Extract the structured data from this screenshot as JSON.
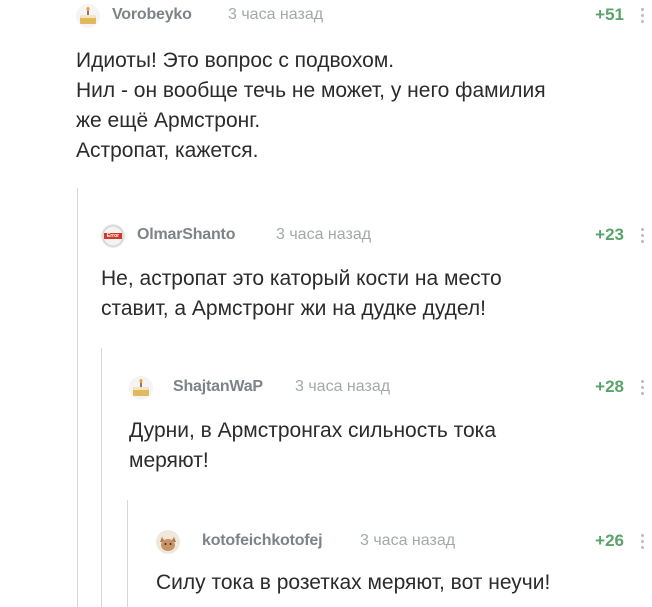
{
  "comments": [
    {
      "username": "Vorobeyko",
      "time": "3 часа назад",
      "rating": "+51",
      "avatar_icon": "cake-icon",
      "lines": [
        "Идиоты! Это вопрос с подвохом.",
        "Нил - он вообще течь не может, у него фамилия",
        "же ещё Армстронг.",
        "Астропат, кажется."
      ]
    },
    {
      "username": "OlmarShanto",
      "time": "3 часа назад",
      "rating": "+23",
      "avatar_icon": "error-badge-icon",
      "avatar_text": "Error",
      "lines": [
        "Не, астропат это каторый кости на место",
        "ставит, а Армстронг жи на дудке дудел!"
      ]
    },
    {
      "username": "ShajtanWaP",
      "time": "3 часа назад",
      "rating": "+28",
      "avatar_icon": "cake-icon",
      "lines": [
        "Дурни, в Армстронгах сильность тока",
        "меряют!"
      ]
    },
    {
      "username": "kotofeichkotofej",
      "time": "3 часа назад",
      "rating": "+26",
      "avatar_icon": "cat-icon",
      "lines": [
        "Силу тока в розетках меряют, вот неучи!"
      ]
    }
  ],
  "colors": {
    "username": "#7d8387",
    "time": "#a3a8ab",
    "rating": "#5aa36a",
    "thread_line": "#d8d8d8"
  }
}
